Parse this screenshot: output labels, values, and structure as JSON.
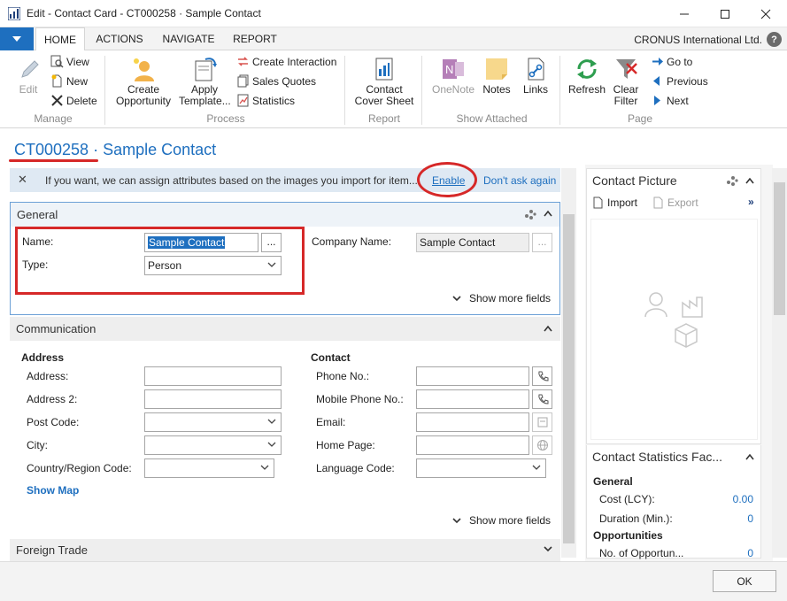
{
  "window": {
    "title": "Edit - Contact Card - CT000258 · Sample Contact"
  },
  "ribbon_tabs": [
    "HOME",
    "ACTIONS",
    "NAVIGATE",
    "REPORT"
  ],
  "company": "CRONUS International Ltd.",
  "help_label": "?",
  "ribbon": {
    "manage": {
      "label": "Manage",
      "edit": "Edit",
      "view": "View",
      "new": "New",
      "delete": "Delete"
    },
    "process": {
      "label": "Process",
      "create_opportunity": "Create Opportunity",
      "apply_template": "Apply Template...",
      "create_interaction": "Create Interaction",
      "sales_quotes": "Sales Quotes",
      "statistics": "Statistics"
    },
    "report": {
      "label": "Report",
      "contact_cover_sheet": "Contact Cover Sheet"
    },
    "show_attached": {
      "label": "Show Attached",
      "onenote": "OneNote",
      "notes": "Notes",
      "links": "Links"
    },
    "page": {
      "label": "Page",
      "refresh": "Refresh",
      "clear_filter": "Clear Filter",
      "go_to": "Go to",
      "previous": "Previous",
      "next": "Next"
    }
  },
  "page_title": {
    "number": "CT000258",
    "separator": "·",
    "name": "Sample Contact"
  },
  "notification": {
    "text": "If you want, we can assign attributes based on the images you import for item...",
    "enable": "Enable",
    "dont_ask": "Don't ask again"
  },
  "general": {
    "header": "General",
    "name_label": "Name:",
    "name_value": "Sample Contact",
    "type_label": "Type:",
    "type_value": "Person",
    "company_label": "Company Name:",
    "company_value": "Sample Contact",
    "show_more": "Show more fields"
  },
  "communication": {
    "header": "Communication",
    "address_head": "Address",
    "contact_head": "Contact",
    "address_label": "Address:",
    "address2_label": "Address 2:",
    "post_code_label": "Post Code:",
    "city_label": "City:",
    "country_label": "Country/Region Code:",
    "show_map": "Show Map",
    "phone_label": "Phone No.:",
    "mobile_label": "Mobile Phone No.:",
    "email_label": "Email:",
    "home_page_label": "Home Page:",
    "language_label": "Language Code:",
    "show_more": "Show more fields"
  },
  "foreign_trade": {
    "header": "Foreign Trade"
  },
  "contact_picture": {
    "header": "Contact Picture",
    "import": "Import",
    "export": "Export"
  },
  "contact_statistics": {
    "header": "Contact Statistics Fac...",
    "general_head": "General",
    "cost_label": "Cost (LCY):",
    "cost_value": "0.00",
    "duration_label": "Duration (Min.):",
    "duration_value": "0",
    "opportunities_head": "Opportunities",
    "opportunities_label": "No. of Opportun...",
    "opportunities_value": "0"
  },
  "ok_label": "OK",
  "colors": {
    "accent": "#1e6fbf",
    "highlight_red": "#d62828",
    "notification_bg": "#dfe9f3"
  }
}
